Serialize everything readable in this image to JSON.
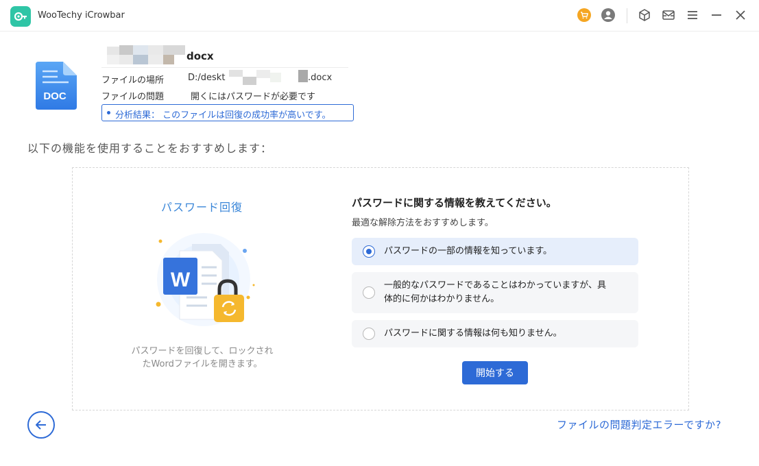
{
  "app": {
    "title": "WooTechy iCrowbar"
  },
  "titlebar": {
    "icons": [
      "cart-icon",
      "user-icon",
      "cube-icon",
      "mail-icon",
      "menu-icon",
      "minimize-icon",
      "close-icon"
    ],
    "accent": "#f5a623"
  },
  "file": {
    "name_suffix": "docx",
    "doc_badge": "DOC",
    "location_label": "ファイルの場所",
    "location_prefix": "D:/deskt",
    "location_suffix": ".docx",
    "problem_label": "ファイルの問題",
    "problem_value": "開くにはパスワードが必要です",
    "result_text": "分析結果： このファイルは回復の成功率が高いです。"
  },
  "recommend_text": "以下の機能を使用することをおすすめします：",
  "feature": {
    "title": "パスワード回復",
    "word_letter": "W",
    "description_line1": "パスワードを回復して、ロックされ",
    "description_line2": "たWordファイルを開きます。"
  },
  "question": {
    "title": "パスワードに関する情報を教えてください。",
    "subtitle": "最適な解除方法をおすすめします。",
    "options": [
      {
        "line1": "パスワードの一部の情報を知っています。",
        "line2": "",
        "selected": true
      },
      {
        "line1": "一般的なパスワードであることはわかっていますが、具",
        "line2": "体的に何かはわかりません。",
        "selected": false
      },
      {
        "line1": "パスワードに関する情報は何も知りません。",
        "line2": "",
        "selected": false
      }
    ]
  },
  "start_button": "開始する",
  "error_link": "ファイルの問題判定エラーですか?",
  "colors": {
    "primary": "#2d6ad6",
    "brand": "#2fc5a6",
    "feature_title": "#3a86d8"
  }
}
